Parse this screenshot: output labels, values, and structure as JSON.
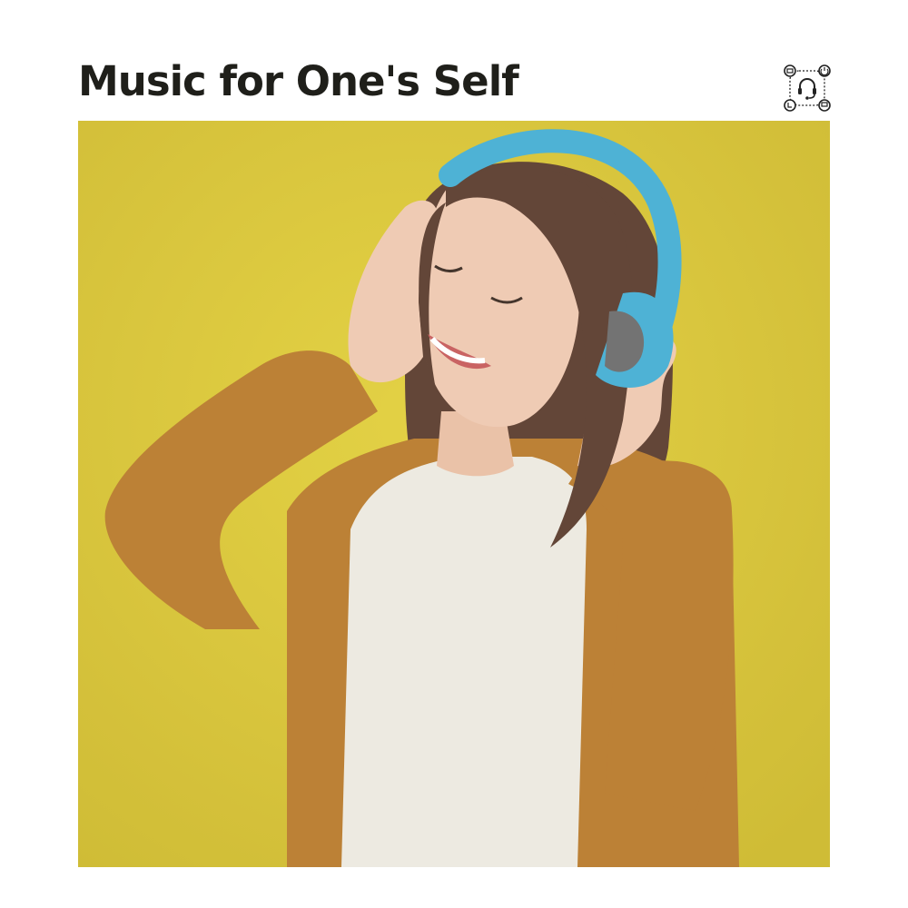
{
  "album": {
    "title": "Music for One's Self"
  },
  "logo": {
    "icon": "headset-circuit-logo-icon"
  },
  "cover_photo": {
    "subject": "woman-with-headphones-photo",
    "colors": {
      "background": "#d9c530",
      "cardigan": "#b87a2a",
      "headphones": "#43aed3",
      "shirt": "#ece9e0",
      "hair": "#5a3b2c",
      "skin": "#efc8b0"
    }
  }
}
